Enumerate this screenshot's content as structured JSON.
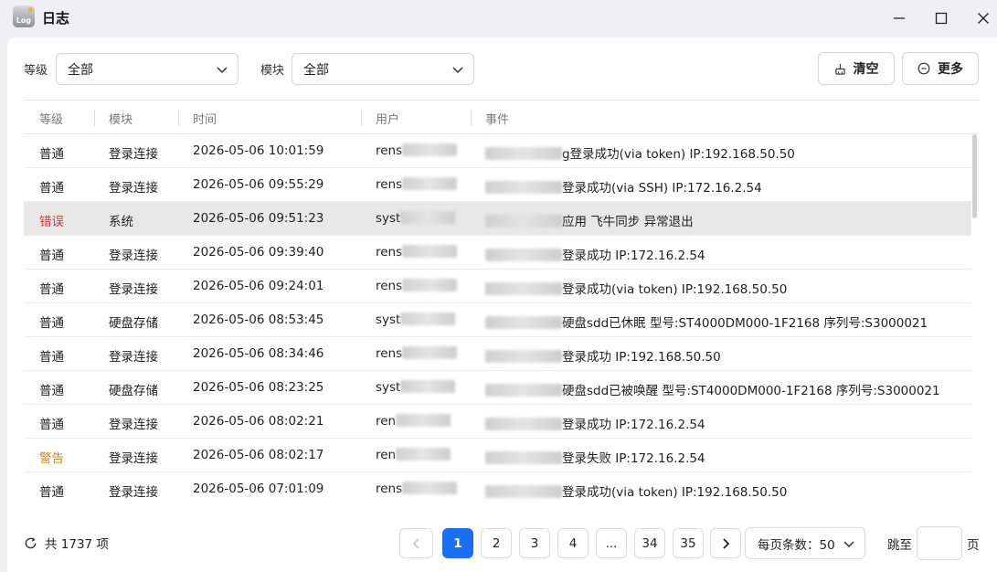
{
  "window": {
    "title": "日志",
    "app_icon_text": "Log"
  },
  "filters": {
    "level_label": "等级",
    "level_value": "全部",
    "module_label": "模块",
    "module_value": "全部"
  },
  "toolbar": {
    "clear_label": "清空",
    "more_label": "更多"
  },
  "table": {
    "columns": [
      "等级",
      "模块",
      "时间",
      "用户",
      "事件"
    ],
    "rows": [
      {
        "level": "普通",
        "level_type": "normal",
        "module": "登录连接",
        "time": "2026-05-06 10:01:59",
        "user": "rens",
        "event": "g登录成功(via token) IP:192.168.50.50"
      },
      {
        "level": "普通",
        "level_type": "normal",
        "module": "登录连接",
        "time": "2026-05-06 09:55:29",
        "user": "rens",
        "event": "登录成功(via SSH) IP:172.16.2.54"
      },
      {
        "level": "错误",
        "level_type": "error",
        "module": "系统",
        "time": "2026-05-06 09:51:23",
        "user": "syst",
        "event": "应用 飞牛同步 异常退出"
      },
      {
        "level": "普通",
        "level_type": "normal",
        "module": "登录连接",
        "time": "2026-05-06 09:39:40",
        "user": "rens",
        "event": "登录成功 IP:172.16.2.54"
      },
      {
        "level": "普通",
        "level_type": "normal",
        "module": "登录连接",
        "time": "2026-05-06 09:24:01",
        "user": "rens",
        "event": "登录成功(via token) IP:192.168.50.50"
      },
      {
        "level": "普通",
        "level_type": "normal",
        "module": "硬盘存储",
        "time": "2026-05-06 08:53:45",
        "user": "syst",
        "event": "硬盘sdd已休眠 型号:ST4000DM000-1F2168 序列号:S3000021"
      },
      {
        "level": "普通",
        "level_type": "normal",
        "module": "登录连接",
        "time": "2026-05-06 08:34:46",
        "user": "rens",
        "event": "登录成功 IP:192.168.50.50"
      },
      {
        "level": "普通",
        "level_type": "normal",
        "module": "硬盘存储",
        "time": "2026-05-06 08:23:25",
        "user": "syst",
        "event": "硬盘sdd已被唤醒 型号:ST4000DM000-1F2168 序列号:S3000021"
      },
      {
        "level": "普通",
        "level_type": "normal",
        "module": "登录连接",
        "time": "2026-05-06 08:02:21",
        "user": "ren",
        "event": "登录成功 IP:172.16.2.54"
      },
      {
        "level": "警告",
        "level_type": "warning",
        "module": "登录连接",
        "time": "2026-05-06 08:02:17",
        "user": "ren",
        "event": "登录失败 IP:172.16.2.54"
      },
      {
        "level": "普通",
        "level_type": "normal",
        "module": "登录连接",
        "time": "2026-05-06 07:01:09",
        "user": "rens",
        "event": "登录成功(via token) IP:192.168.50.50"
      }
    ]
  },
  "footer": {
    "total_text": "共 1737 项",
    "pages": [
      "1",
      "2",
      "3",
      "4",
      "...",
      "34",
      "35"
    ],
    "current_page": "1",
    "page_size_text": "每页条数：50",
    "jump_label": "跳至",
    "page_suffix": "页"
  },
  "colors": {
    "accent": "#1a6ff5",
    "error": "#d63c3c",
    "warning": "#e0801d"
  }
}
